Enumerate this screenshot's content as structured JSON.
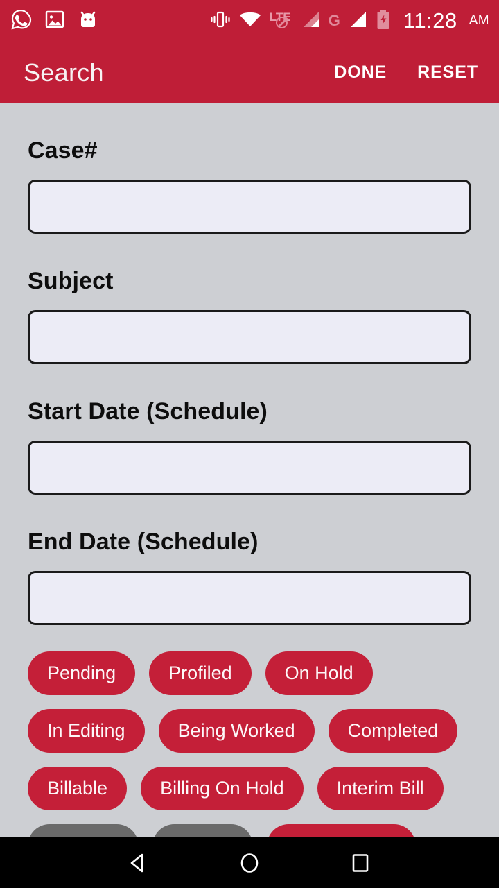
{
  "statusbar": {
    "icons_left": [
      "whatsapp-icon",
      "screenshot-image-icon",
      "android-face-icon"
    ],
    "icons_right": [
      "vibrate-icon",
      "wifi-icon",
      "lte-disabled-icon",
      "signal-bars-icon-1",
      "gprs-g-icon",
      "signal-bars-icon-2",
      "battery-charging-icon"
    ],
    "lte_label": "LTE",
    "g_label": "G",
    "time": "11:28",
    "ampm": "AM"
  },
  "appbar": {
    "title": "Search",
    "done_label": "DONE",
    "reset_label": "RESET"
  },
  "form": {
    "fields": [
      {
        "label": "Case#",
        "value": "",
        "placeholder": ""
      },
      {
        "label": "Subject",
        "value": "",
        "placeholder": ""
      },
      {
        "label": "Start Date (Schedule)",
        "value": "",
        "placeholder": ""
      },
      {
        "label": "End Date (Schedule)",
        "value": "",
        "placeholder": ""
      }
    ]
  },
  "chips": {
    "rows": [
      [
        {
          "label": "Pending",
          "selected": true
        },
        {
          "label": "Profiled",
          "selected": true
        },
        {
          "label": "On Hold",
          "selected": true
        }
      ],
      [
        {
          "label": "In Editing",
          "selected": true
        },
        {
          "label": "Being Worked",
          "selected": true
        },
        {
          "label": "Completed",
          "selected": true
        }
      ],
      [
        {
          "label": "Billable",
          "selected": true
        },
        {
          "label": "Billing On Hold",
          "selected": true
        },
        {
          "label": "Interim Bill",
          "selected": true
        }
      ],
      [
        {
          "label": "",
          "selected": false
        },
        {
          "label": "",
          "selected": false
        },
        {
          "label": "",
          "selected": true
        }
      ]
    ]
  },
  "navbar": {
    "back": "back-icon",
    "home": "home-icon",
    "recents": "recents-icon"
  },
  "colors": {
    "brand_red": "#bf1e37",
    "chip_red": "#c41f38",
    "chip_gray": "#6a6a6a",
    "page_bg": "#cdcfd3",
    "input_bg": "#ececf6",
    "navbar_bg": "#000000"
  }
}
